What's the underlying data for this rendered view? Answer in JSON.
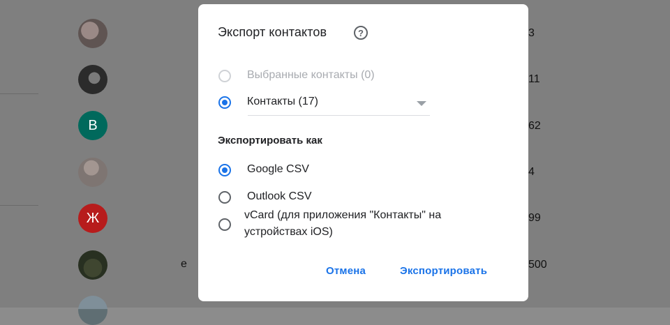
{
  "background": {
    "contacts": [
      {
        "avatar_letter": "",
        "name": "",
        "phone": "3"
      },
      {
        "avatar_letter": "",
        "name": "",
        "phone": "11"
      },
      {
        "avatar_letter": "В",
        "name": "",
        "phone": "62"
      },
      {
        "avatar_letter": "",
        "name": "",
        "phone": "4"
      },
      {
        "avatar_letter": "Ж",
        "name": "",
        "phone": "99"
      },
      {
        "avatar_letter": "",
        "name": "е",
        "phone": "500"
      },
      {
        "avatar_letter": "",
        "name": "",
        "phone": ""
      }
    ]
  },
  "dialog": {
    "title": "Экспорт контактов",
    "help_icon_glyph": "?",
    "selection": {
      "options": [
        {
          "label": "Выбранные контакты (0)",
          "checked": false,
          "disabled": true
        },
        {
          "label": "Контакты (17)",
          "checked": true,
          "disabled": false
        }
      ]
    },
    "format_heading": "Экспортировать как",
    "formats": [
      {
        "label": "Google CSV",
        "checked": true
      },
      {
        "label": "Outlook CSV",
        "checked": false
      },
      {
        "label_line1": "vCard (для приложения \"Контакты\" на",
        "label_line2": "устройствах iOS)",
        "checked": false
      }
    ],
    "cancel_label": "Отмена",
    "export_label": "Экспортировать"
  },
  "colors": {
    "accent": "#1a73e8",
    "overlay": "#7f7f7f"
  }
}
